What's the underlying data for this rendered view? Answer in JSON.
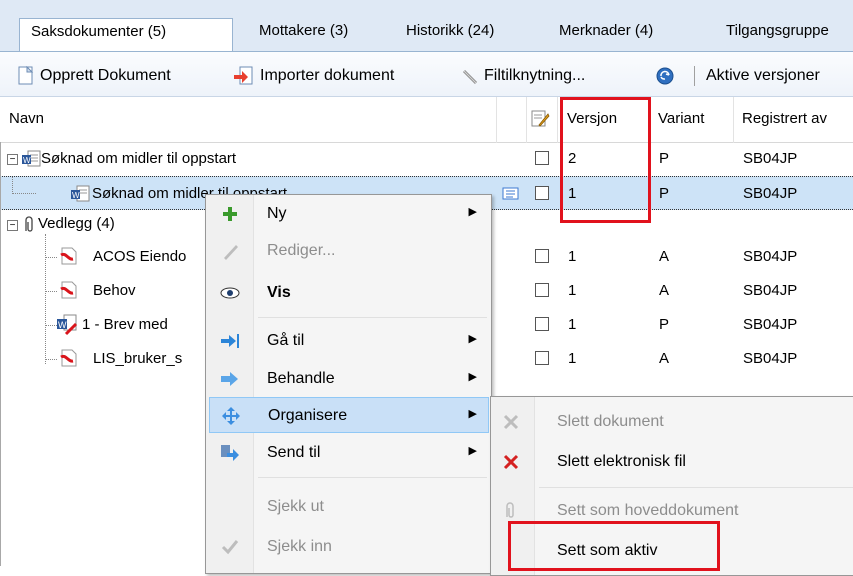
{
  "tabs": [
    {
      "label": "Saksdokumenter (5)",
      "active": true
    },
    {
      "label": "Mottakere (3)"
    },
    {
      "label": "Historikk (24)"
    },
    {
      "label": "Merknader (4)"
    },
    {
      "label": "Tilgangsgruppe"
    }
  ],
  "toolbar": {
    "create_label": "Opprett Dokument",
    "import_label": "Importer dokument",
    "link_label": "Filtilknytning...",
    "active_label": "Aktive versjoner"
  },
  "columns": {
    "name": "Navn",
    "version": "Versjon",
    "variant": "Variant",
    "registered": "Registrert av"
  },
  "rows": [
    {
      "name": "Søknad om midler til oppstart",
      "version": "2",
      "variant": "P",
      "registered": "SB04JP"
    },
    {
      "name": "Søknad om midler til oppstart",
      "version": "1",
      "variant": "P",
      "registered": "SB04JP"
    },
    {
      "name": "Vedlegg (4)",
      "version": "",
      "variant": "",
      "registered": ""
    },
    {
      "name": "ACOS Eiendo",
      "version": "1",
      "variant": "A",
      "registered": "SB04JP"
    },
    {
      "name": "Behov",
      "version": "1",
      "variant": "A",
      "registered": "SB04JP"
    },
    {
      "name": "1 - Brev med",
      "version": "1",
      "variant": "P",
      "registered": "SB04JP"
    },
    {
      "name": "LIS_bruker_s",
      "version": "1",
      "variant": "A",
      "registered": "SB04JP"
    }
  ],
  "context_menu": {
    "items": [
      {
        "label": "Ny",
        "icon": "plus-icon"
      },
      {
        "label": "Rediger...",
        "icon": "pencil-icon"
      },
      {
        "label": "Vis",
        "icon": "eye-icon"
      },
      {
        "label": "Gå til",
        "icon": "goto-arrow-icon"
      },
      {
        "label": "Behandle",
        "icon": "process-arrow-icon"
      },
      {
        "label": "Organisere",
        "icon": "move-icon"
      },
      {
        "label": "Send til",
        "icon": "send-icon"
      },
      {
        "label": "Sjekk ut"
      },
      {
        "label": "Sjekk inn",
        "icon": "check-icon"
      }
    ]
  },
  "submenu": {
    "items": [
      {
        "label": "Slett dokument",
        "icon": "delete-x-icon"
      },
      {
        "label": "Slett elektronisk fil",
        "icon": "delete-x-icon"
      },
      {
        "label": "Sett som hoveddokument",
        "icon": "paperclip-icon"
      },
      {
        "label": "Sett som aktiv"
      }
    ]
  },
  "colors": {
    "highlight": "#c9e0f7",
    "annotation_red": "#e1121d",
    "tab_bar": "#dfe9f5"
  }
}
